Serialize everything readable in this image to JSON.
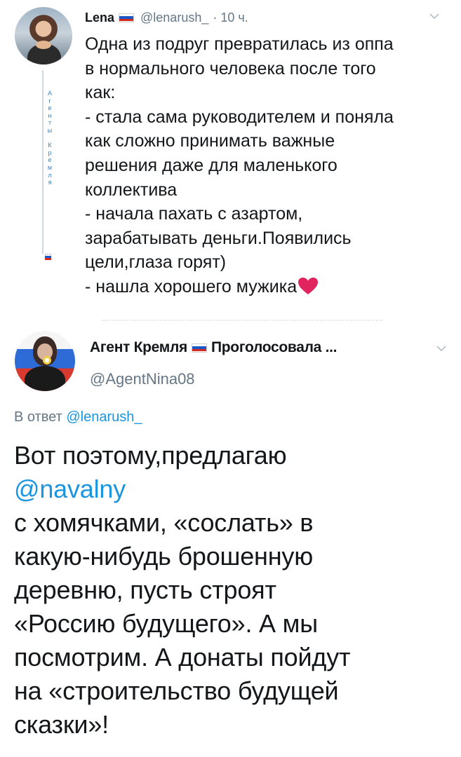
{
  "tweet1": {
    "author_name": "Lena",
    "handle": "@lenarush_",
    "time": "· 10 ч.",
    "body": "Одна из подруг превратилась из оппа\nв нормального человека после того\nкак:\n- стала сама руководителем и поняла\nкак сложно принимать важные\nрешения даже для маленького\nколлектива\n- начала пахать с азартом,\nзарабатывать деньги.Появились\nцели,глаза горят)\n- нашла хорошего мужика",
    "side_label": "Агенты Кремля"
  },
  "tweet2": {
    "author_name": "Агент Кремля",
    "author_suffix": "Проголосовала ...",
    "handle": "@AgentNina08",
    "reply_prefix": "В ответ",
    "reply_handle": "@lenarush_",
    "body_lines": [
      "Вот поэтому,предлагаю",
      "@navalny",
      "с хомячками, «сослать» в",
      "какую-нибудь брошенную",
      "деревню, пусть строят",
      "«Россию будущего». А мы",
      "посмотрим. А донаты пойдут",
      "на «строительство будущей",
      "сказки»!"
    ]
  },
  "colors": {
    "link": "#1b95e0",
    "secondary_text": "#657786",
    "flag_white": "#ffffff",
    "flag_blue": "#1c57c7",
    "flag_red": "#d52b1e",
    "heart": "#e0245e"
  },
  "icons": [
    "russia-flag-icon",
    "chevron-down-icon",
    "red-heart-emoji"
  ]
}
